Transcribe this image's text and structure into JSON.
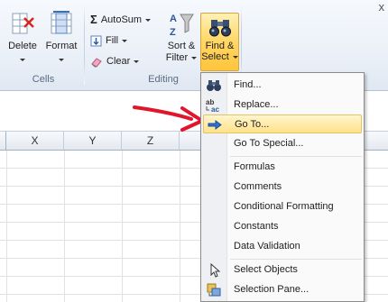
{
  "ribbon": {
    "delete_label": "Delete",
    "format_label": "Format",
    "cells_group": "Cells",
    "autosum_label": "AutoSum",
    "fill_label": "Fill",
    "clear_label": "Clear",
    "sort_label_1": "Sort &",
    "sort_label_2": "Filter",
    "find_label_1": "Find &",
    "find_label_2": "Select",
    "editing_group": "Editing",
    "close_glyph": "x"
  },
  "columns": [
    "X",
    "Y",
    "Z"
  ],
  "menu": {
    "items": [
      {
        "label": "Find...",
        "icon": "binoculars-icon"
      },
      {
        "label": "Replace...",
        "icon": "replace-icon"
      },
      {
        "label": "Go To...",
        "icon": "goto-arrow-icon",
        "highlighted": true
      },
      {
        "label": "Go To Special..."
      },
      {
        "label": "Formulas"
      },
      {
        "label": "Comments"
      },
      {
        "label": "Conditional Formatting"
      },
      {
        "label": "Constants"
      },
      {
        "label": "Data Validation"
      },
      {
        "label": "Select Objects",
        "icon": "pointer-icon"
      },
      {
        "label": "Selection Pane...",
        "icon": "selection-pane-icon"
      }
    ]
  },
  "colors": {
    "highlight": "#ffe28a",
    "arrow": "#e0162b",
    "ribbon": "#e9eff7"
  }
}
